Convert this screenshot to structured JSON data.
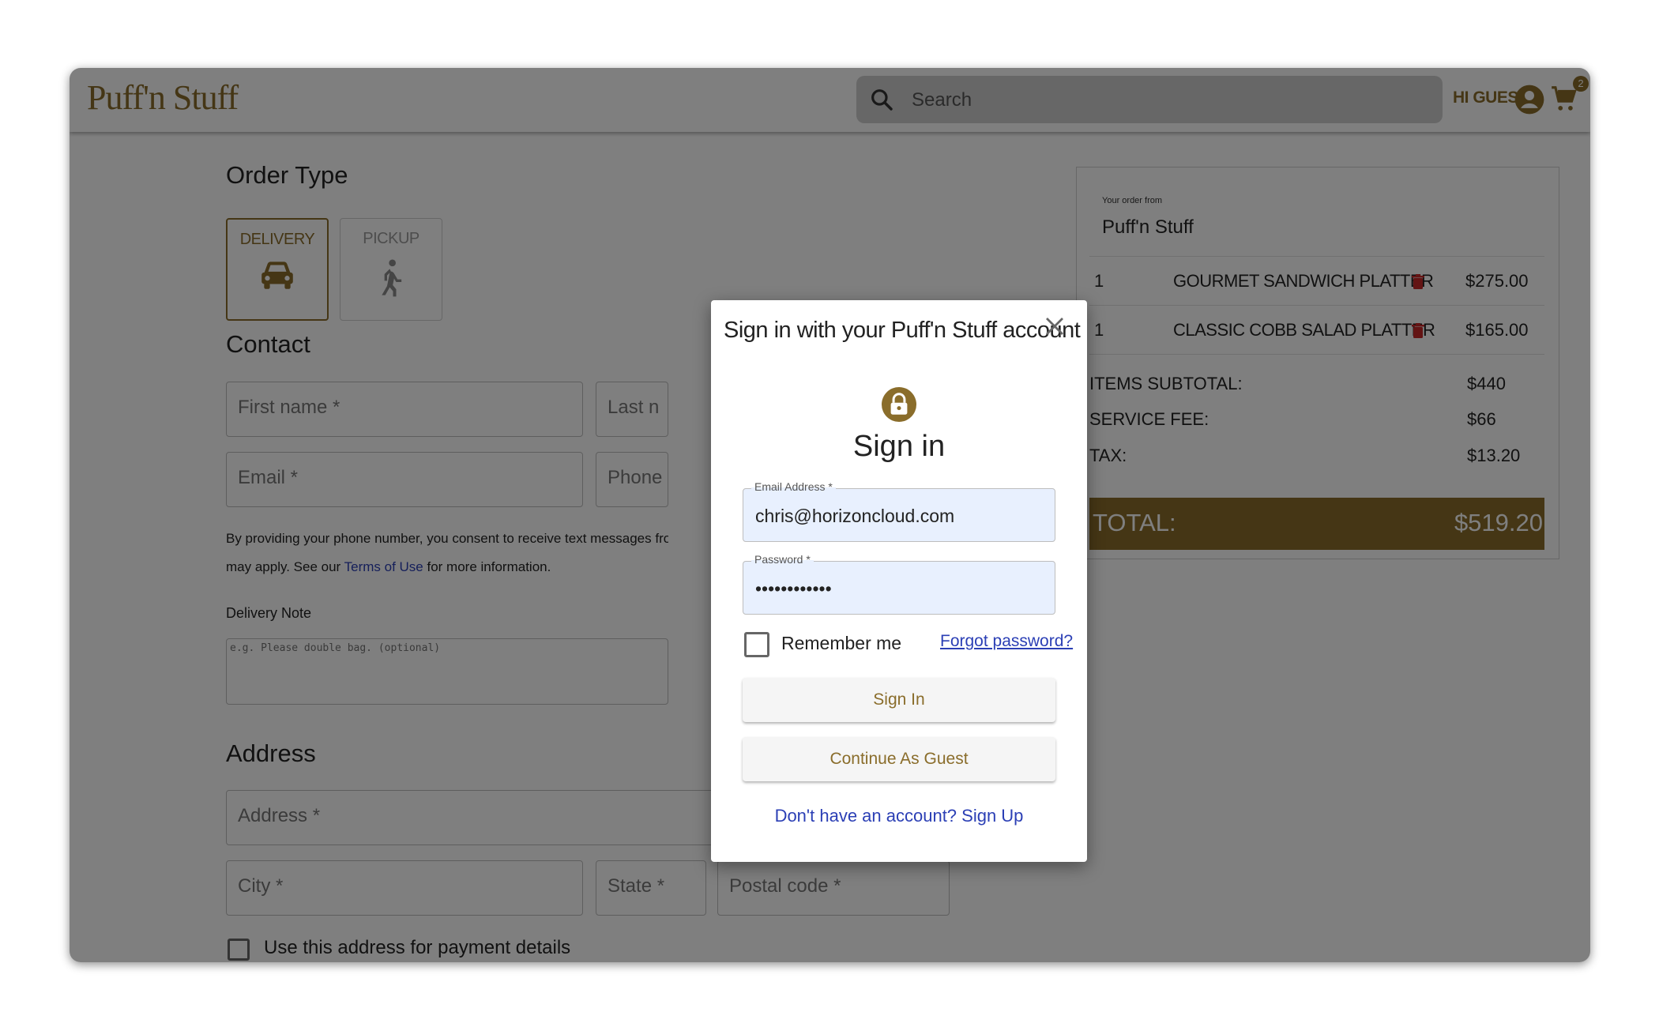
{
  "header": {
    "logo": "Puff'n Stuff",
    "logo_small": "n",
    "logo_sub": "",
    "search_placeholder": "Search",
    "greeting": "HI GUEST",
    "cart_count": "2"
  },
  "order_type": {
    "title": "Order Type",
    "options": [
      {
        "label": "DELIVERY",
        "active": true
      },
      {
        "label": "PICKUP",
        "active": false
      }
    ]
  },
  "contact": {
    "title": "Contact",
    "first_name": "First name *",
    "last_name": "Last n",
    "email": "Email *",
    "phone": "Phone",
    "consent_line1": "By providing your phone number, you consent to receive text messages from Puf",
    "consent_line2_prefix": "may apply. See our ",
    "consent_link": "Terms of Use",
    "consent_line2_suffix": " for more information."
  },
  "delivery_note": {
    "label": "Delivery Note",
    "placeholder": "e.g. Please double bag. (optional)"
  },
  "address": {
    "title": "Address",
    "address": "Address *",
    "city": "City *",
    "state": "State *",
    "postal": "Postal code *",
    "use_for_payment": "Use this address for payment details"
  },
  "order": {
    "from_label": "Your order from",
    "from": "Puff'n Stuff",
    "items": [
      {
        "qty": "1",
        "name": "GOURMET SANDWICH PLATTER",
        "price": "$275.00"
      },
      {
        "qty": "1",
        "name": "CLASSIC COBB SALAD PLATTER",
        "price": "$165.00"
      }
    ],
    "subtotal_label": "ITEMS SUBTOTAL:",
    "subtotal": "$440",
    "service_label": "SERVICE FEE:",
    "service": "$66",
    "tax_label": "TAX:",
    "tax": "$13.20",
    "total_label": "TOTAL:",
    "total": "$519.20"
  },
  "modal": {
    "title": "Sign in with your Puff'n Stuff account",
    "heading": "Sign in",
    "email_label": "Email Address *",
    "email_value": "chris@horizoncloud.com",
    "password_label": "Password *",
    "password_value": "passwordpass",
    "remember": "Remember me",
    "forgot": "Forgot password?",
    "sign_in": "Sign In",
    "guest": "Continue As Guest",
    "signup": "Don't have an account? Sign Up"
  },
  "colors": {
    "brand": "#8a6d2b",
    "link": "#2b3fb5",
    "autofill": "#e8f0fe"
  }
}
